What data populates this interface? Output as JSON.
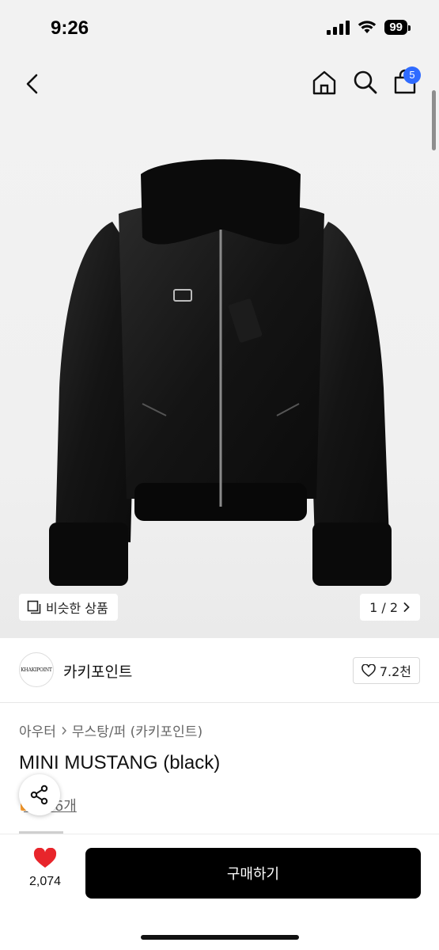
{
  "status_bar": {
    "time": "9:26",
    "battery": "99"
  },
  "nav": {
    "cart_count": "5"
  },
  "gallery": {
    "similar_label": "비슷한 상품",
    "pager": "1 / 2"
  },
  "brand": {
    "logo_text": "KHAKIPOINT",
    "name": "카키포인트",
    "likes": "7.2천"
  },
  "breadcrumb": {
    "category": "아우터",
    "subcategory": "무스탕/퍼 (카키포인트)"
  },
  "product": {
    "title": "MINI MUSTANG (black)",
    "reviews_link": "후기 6개"
  },
  "bottom": {
    "wish_count": "2,074",
    "buy_label": "구매하기"
  },
  "colors": {
    "badge": "#2f6bff",
    "heart": "#e8252b",
    "buy_button": "#000000"
  },
  "icons": [
    "chevron-left-icon",
    "home-icon",
    "search-icon",
    "shopping-bag-icon",
    "gallery-icon",
    "chevron-right-icon",
    "heart-outline-icon",
    "share-icon",
    "heart-filled-icon"
  ]
}
